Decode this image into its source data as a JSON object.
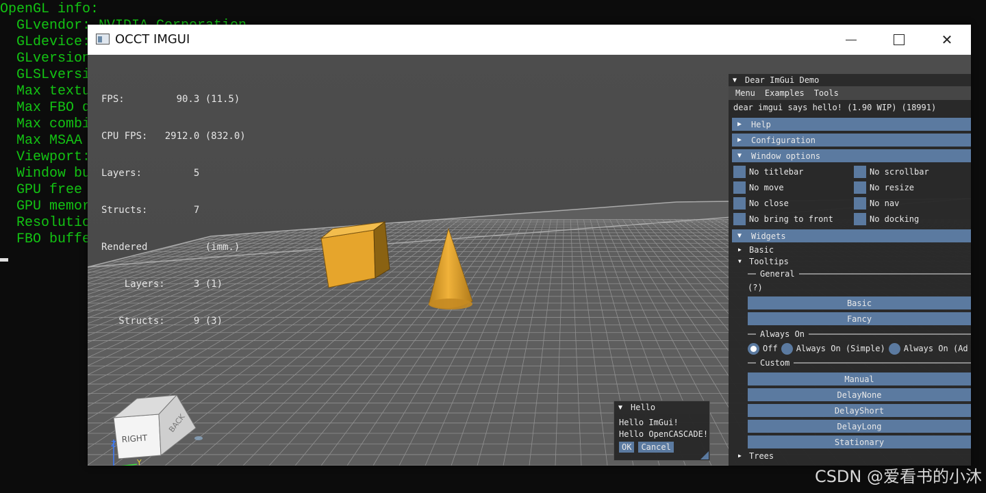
{
  "console": {
    "lines": [
      "OpenGL info:",
      "  GLvendor: NVIDIA Corporation",
      "  GLdevice:",
      "  GLversion",
      "  GLSLversi",
      "  Max textu",
      "  Max FBO d",
      "  Max combi",
      "  Max MSAA",
      "  Viewport:",
      "  Window bu",
      "  GPU free",
      "  GPU memor",
      "  Resolutio",
      "  FBO buffe"
    ]
  },
  "watermark": "CSDN @爱看书的小沐",
  "window": {
    "title": "OCCT IMGUI",
    "minimize_icon": "minimize-icon",
    "maximize_icon": "maximize-icon",
    "close_label": "✕"
  },
  "stats": {
    "lines": [
      "FPS:         90.3 (11.5)",
      "CPU FPS:   2912.0 (832.0)",
      "Layers:         5",
      "Structs:        7",
      "Rendered          (imm.)",
      "    Layers:     3 (1)",
      "   Structs:     9 (3)"
    ]
  },
  "viewcube": {
    "right": "RIGHT",
    "back": "BACK",
    "axis_z": "Z",
    "axis_y": "Y",
    "axis_x": "X"
  },
  "demo": {
    "title": "Dear ImGui Demo",
    "menu": [
      "Menu",
      "Examples",
      "Tools"
    ],
    "hello_text": "dear imgui says hello! (1.90 WIP) (18991)",
    "headers": {
      "help": "Help",
      "configuration": "Configuration",
      "window_options": "Window options",
      "widgets": "Widgets"
    },
    "window_options": [
      "No titlebar",
      "No scrollbar",
      "No move",
      "No resize",
      "No close",
      "No nav",
      "No bring to front",
      "No docking"
    ],
    "tree": {
      "basic": "Basic",
      "tooltips": "Tooltips",
      "trees": "Trees"
    },
    "sections": {
      "general": "General",
      "always_on": "Always On",
      "custom": "Custom"
    },
    "help_marker": "(?)",
    "general_buttons": [
      "Basic",
      "Fancy"
    ],
    "radios": [
      "Off",
      "Always On (Simple)",
      "Always On (Ad"
    ],
    "custom_buttons": [
      "Manual",
      "DelayNone",
      "DelayShort",
      "DelayLong",
      "Stationary"
    ]
  },
  "hello_window": {
    "title": "Hello",
    "lines": [
      "Hello ImGui!",
      "Hello OpenCASCADE!"
    ],
    "ok": "OK",
    "cancel": "Cancel"
  },
  "colors": {
    "console_text": "#13c313",
    "imgui_accent": "#5b7aa0",
    "shape_fill": "#e3a12a"
  }
}
